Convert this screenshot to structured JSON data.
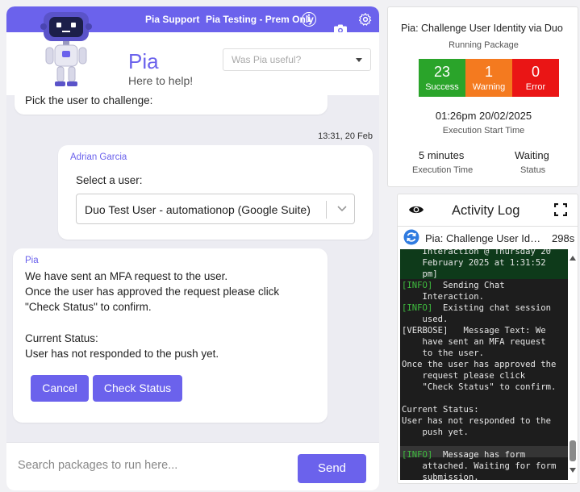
{
  "chat": {
    "topbar": {
      "support_label": "Pia Support",
      "testing_label": "Pia Testing - Prem Only",
      "info_icon": "i"
    },
    "header": {
      "title": "Pia",
      "subtitle": "Here to help!",
      "feedback_placeholder": "Was Pia useful?"
    },
    "messages": {
      "bubble1_text": "Pick the user to challenge:",
      "timestamp": "13:31, 20 Feb",
      "user_card": {
        "name": "Adrian Garcia",
        "label": "Select a user:",
        "selected_value": "Duo Test User - automationop (Google Suite)"
      },
      "pia_card": {
        "name": "Pia",
        "lines": [
          "We have sent an MFA request to the user.",
          "Once the user has approved the request please click",
          "\"Check Status\" to confirm.",
          "Current Status:",
          "User has not responded to the push yet."
        ],
        "cancel_label": "Cancel",
        "check_label": "Check Status"
      }
    },
    "input": {
      "placeholder": "Search packages to run here...",
      "send_label": "Send"
    }
  },
  "package": {
    "title": "Pia: Challenge User Identity via Duo",
    "status": "Running Package",
    "counts": {
      "success": "23",
      "success_label": "Success",
      "warning": "1",
      "warning_label": "Warning",
      "error": "0",
      "error_label": "Error"
    },
    "start_time": "01:26pm 20/02/2025",
    "start_label": "Execution Start Time",
    "exec_time": "5 minutes",
    "exec_label": "Execution Time",
    "state": "Waiting",
    "state_label": "Status"
  },
  "activity_log": {
    "title": "Activity Log",
    "package_name": "Pia: Challenge User Identity via Duo",
    "duration": "298s",
    "lines": [
      {
        "tag": "",
        "text": "    Interaction @ Thursday 20"
      },
      {
        "tag": "",
        "text": "    February 2025 at 1:31:52"
      },
      {
        "tag": "",
        "text": "    pm]"
      },
      {
        "tag": "[INFO]",
        "text": "  Sending Chat"
      },
      {
        "tag": "",
        "text": "    Interaction."
      },
      {
        "tag": "[INFO]",
        "text": "  Existing chat session"
      },
      {
        "tag": "",
        "text": "    used."
      },
      {
        "tag": "",
        "text": "[VERBOSE]   Message Text: We"
      },
      {
        "tag": "",
        "text": "    have sent an MFA request"
      },
      {
        "tag": "",
        "text": "    to the user."
      },
      {
        "tag": "",
        "text": "Once the user has approved the"
      },
      {
        "tag": "",
        "text": "    request please click"
      },
      {
        "tag": "",
        "text": "    \"Check Status\" to confirm."
      },
      {
        "tag": "",
        "text": ""
      },
      {
        "tag": "",
        "text": "Current Status:"
      },
      {
        "tag": "",
        "text": "User has not responded to the"
      },
      {
        "tag": "",
        "text": "    push yet."
      },
      {
        "tag": "",
        "text": ""
      },
      {
        "tag": "[INFO]",
        "text": "  Message has form"
      },
      {
        "tag": "",
        "text": "    attached. Waiting for form"
      },
      {
        "tag": "",
        "text": "    submission."
      }
    ]
  },
  "colors": {
    "accent": "#6b62ec",
    "success": "#2aa42a",
    "warning": "#f47a1f",
    "error": "#ea1515",
    "console_bg": "#1d1d1d",
    "console_tag": "#3fbf3f"
  },
  "icons": [
    "info-icon",
    "gear-icon",
    "camera-icon",
    "chevron-down-icon",
    "eye-icon",
    "expand-icon",
    "refresh-icon"
  ]
}
